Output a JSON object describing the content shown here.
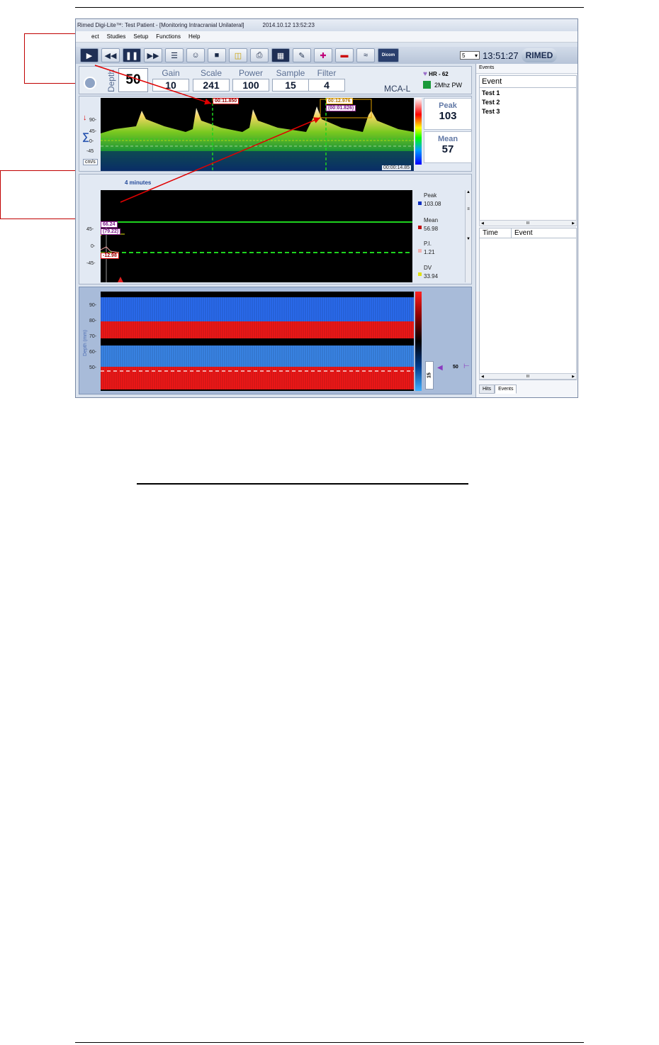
{
  "window": {
    "title": "Rimed Digi-Lite™: Test Patient - [Monitoring Intracranial Unilateral]",
    "datetime": "2014.10.12 13:52:23"
  },
  "menu": [
    "ect",
    "Studies",
    "Setup",
    "Functions",
    "Help"
  ],
  "toolbar": {
    "dicom_label": "Dicom",
    "spin_value": "5",
    "clock": "13:51:27",
    "logo": "RIMED"
  },
  "controls": {
    "depth_label": "Depth",
    "depth_value": "50",
    "gain_label": "Gain",
    "gain_value": "10",
    "scale_label": "Scale",
    "scale_value": "241",
    "power_label": "Power",
    "power_value": "100",
    "sample_label": "Sample",
    "sample_value": "15",
    "filter_label": "Filter",
    "filter_value": "4",
    "vessel": "MCA-L",
    "hr": "HR - 62",
    "probe": "2Mhz PW"
  },
  "spectrum": {
    "yticks": [
      "90-",
      "45-",
      "0-",
      "-45"
    ],
    "unit": "cm/s",
    "time": "00:00:14.85",
    "marker1": "00:11.850",
    "marker2_top": "00:12.976",
    "marker2_bottom": "(00:01.826)",
    "peak_label": "Peak",
    "peak_value": "103",
    "mean_label": "Mean",
    "mean_value": "57"
  },
  "trend": {
    "header": "4 minutes",
    "yticks": [
      "45-",
      "0-",
      "-45-"
    ],
    "val_top": "66.24",
    "val_paren": "(79.22)",
    "val_neg": "-12.98",
    "legend": [
      {
        "label": "Peak",
        "value": "103.08",
        "color": "#1030c0"
      },
      {
        "label": "Mean",
        "value": "56.98",
        "color": "#c01010"
      },
      {
        "label": "P.I.",
        "value": "1.21",
        "color": "#f0b0b0"
      },
      {
        "label": "DV",
        "value": "33.94",
        "color": "#e0e010"
      }
    ]
  },
  "depthmode": {
    "axis_label": "Depth (mm)",
    "yticks": [
      "90-",
      "80-",
      "70-",
      "60-",
      "50-"
    ],
    "gate_value": "15",
    "depth_marker": "50"
  },
  "events": {
    "panel_title": "Events",
    "column": "Event",
    "items": [
      "Test 1",
      "Test 2",
      "Test 3"
    ],
    "table_cols": [
      "Time",
      "Event"
    ],
    "tabs": [
      "Hits",
      "Events"
    ],
    "scroll_mark": "III"
  }
}
